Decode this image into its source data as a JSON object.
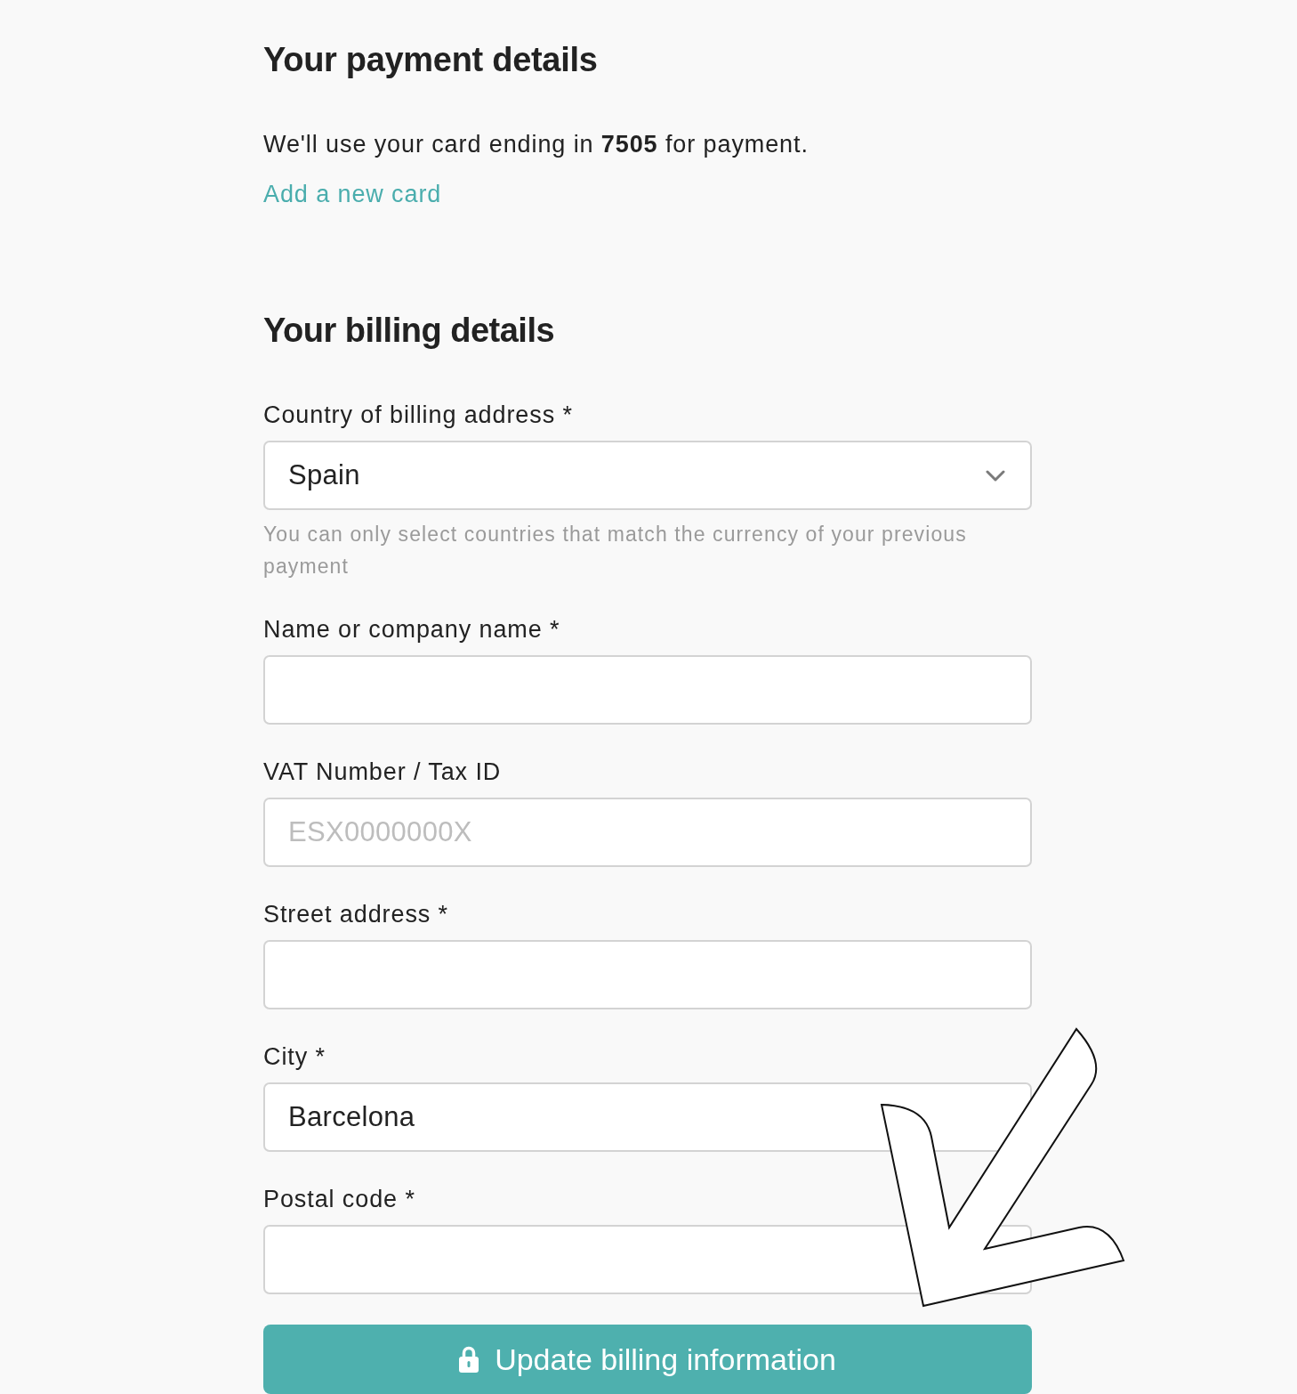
{
  "payment": {
    "title": "Your payment details",
    "card_text": "We'll use your card ending in **7505** for payment.",
    "link": "Add a new card"
  },
  "billing": {
    "title": "Your billing details",
    "fields": [
      {
        "kind": "select",
        "label": "Country of billing address *",
        "value": "Spain",
        "hint": "You can only select countries that match the currency of your previous payment"
      },
      {
        "kind": "text",
        "label": "Name or company name *"
      },
      {
        "kind": "text",
        "label": "VAT Number / Tax ID",
        "placeholder": "ESX0000000X"
      },
      {
        "kind": "text",
        "label": "Street address *"
      },
      {
        "kind": "text",
        "label": "City *",
        "value": "Barcelona"
      },
      {
        "kind": "text",
        "label": "Postal code *"
      }
    ],
    "submit": "Update billing information"
  },
  "annotation": {
    "kind": "arrow"
  }
}
